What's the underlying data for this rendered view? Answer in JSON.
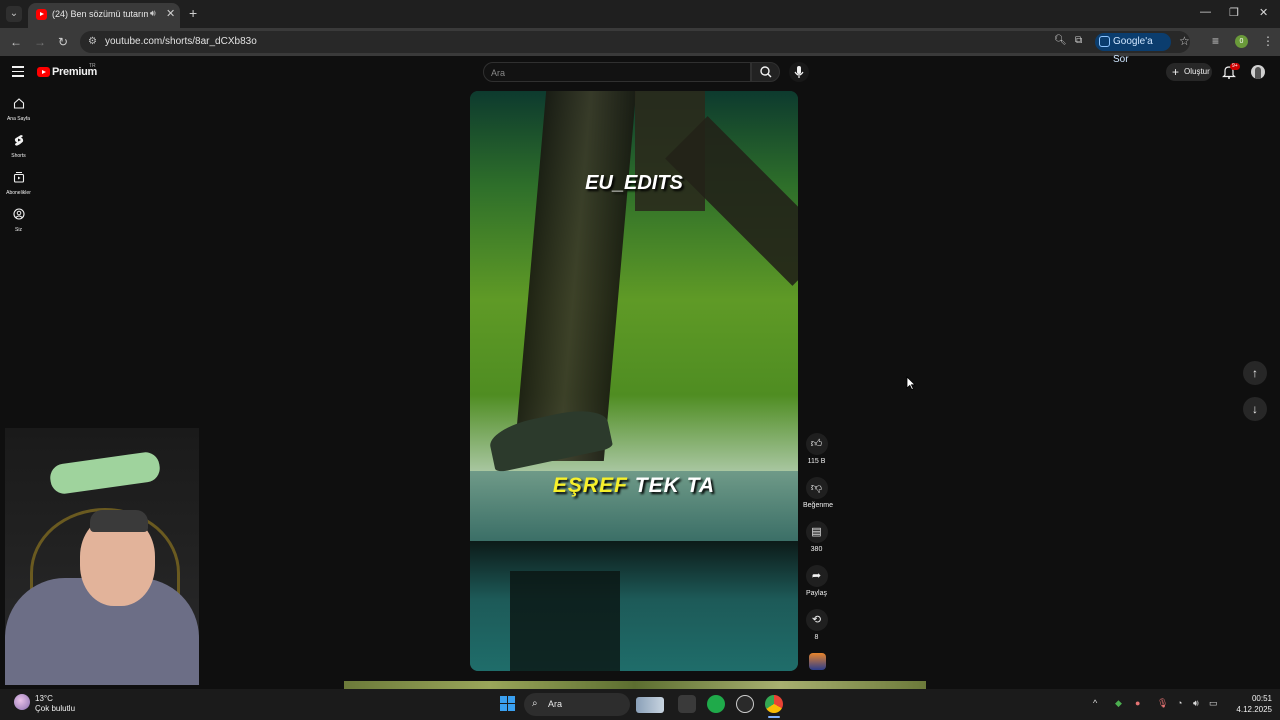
{
  "browser": {
    "tab_title": "(24) Ben sözümü tutarım #",
    "url": "youtube.com/shorts/8ar_dCXb83o",
    "google_ask_label": "Google'a Sor",
    "profile_initial": "0"
  },
  "youtube": {
    "logo_text": "Premium",
    "logo_region": "TR",
    "search_placeholder": "Ara",
    "create_label": "Oluştur",
    "notification_count": "9+",
    "nav": [
      {
        "label": "Ana Sayfa",
        "icon": "home-icon"
      },
      {
        "label": "Shorts",
        "icon": "shorts-icon"
      },
      {
        "label": "Abonelikler",
        "icon": "subscriptions-icon"
      },
      {
        "label": "Siz",
        "icon": "you-icon"
      }
    ]
  },
  "short": {
    "watermark": "EU_EDITS",
    "subtitle_highlight": "EŞREF",
    "subtitle_rest": "TEK TA",
    "like_count": "115 B",
    "dislike_label": "Beğenme",
    "comment_count": "380",
    "share_label": "Paylaş",
    "remix_count": "8"
  },
  "taskbar": {
    "weather_temp": "13°C",
    "weather_desc": "Çok bulutlu",
    "search_label": "Ara",
    "time": "00:51",
    "date": "4.12.2025"
  },
  "colors": {
    "background": "#0f0f0f",
    "youtube_red": "#ff0000",
    "subtitle_yellow": "#f7f02b",
    "google_ask_bg": "#0b3d6e"
  }
}
